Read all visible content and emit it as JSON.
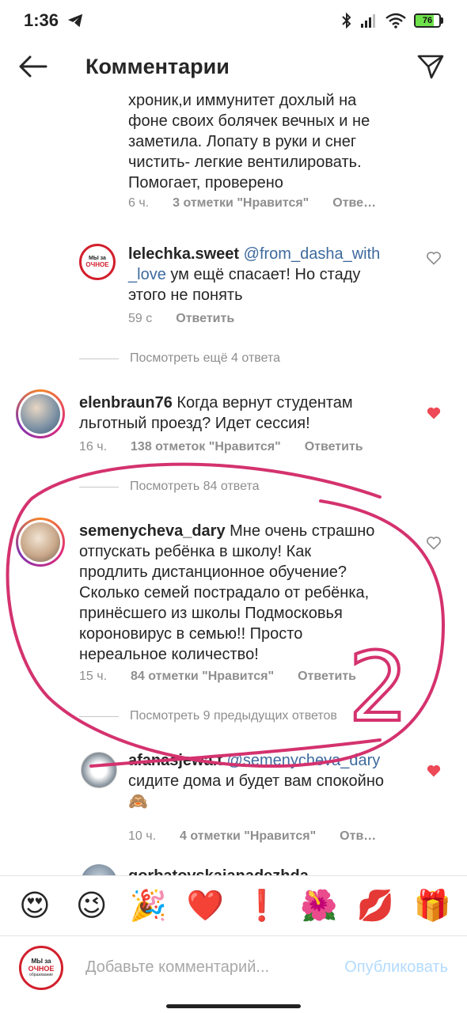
{
  "status": {
    "time": "1:36",
    "battery": "76",
    "battery_level": 0.76
  },
  "header": {
    "title": "Комментарии"
  },
  "comments": [
    {
      "text_lines": [
        "хроник,и иммунитет дохлый  на",
        "фоне своих болячек вечных и не",
        "заметила. Лопату в руки и снег",
        "чистить- легкие вентилировать.",
        "Помогает, проверено"
      ],
      "time": "6 ч.",
      "likes": "3 отметки \"Нравится\"",
      "reply": "Отве…"
    },
    {
      "username": "lelechka.sweet",
      "mention_a": "@from_dasha_with",
      "mention_b": "_love",
      "text_a": " ум ещё спасает! Но стаду",
      "text_b": "этого не понять",
      "time": "59 с",
      "reply": "Ответить"
    },
    {
      "view_more": "Посмотреть ещё 4 ответа"
    },
    {
      "username": "elenbraun76",
      "text_a": " Когда вернут студентам",
      "text_b": "льготный проезд? Идет сессия!",
      "time": "16 ч.",
      "likes": "138 отметок \"Нравится\"",
      "reply": "Ответить"
    },
    {
      "view_more": "Посмотреть 84 ответа"
    },
    {
      "username": "semenycheva_dary",
      "text_a": " Мне очень страшно",
      "text_lines": [
        "отпускать ребёнка в школу! Как",
        "продлить дистанционное обучение?",
        "Сколько семей пострадало от ребёнка,",
        "принёсшего из школы Подмосковья",
        "короновирус в семью!! Просто",
        "нереальное количество!"
      ],
      "time": "15 ч.",
      "likes": "84 отметки \"Нравится\"",
      "reply": "Ответить"
    },
    {
      "view_more": "Посмотреть 9 предыдущих ответов"
    },
    {
      "username": "afanasjewa.t",
      "mention_a": "@semenycheva_dary",
      "text_b": "сидите дома и будет вам спокойно",
      "emoji": "🙈",
      "time": "10 ч.",
      "likes": "4 отметки \"Нравится\"",
      "reply": "Отв…"
    },
    {
      "username": "gorbatovskajanadezhda"
    }
  ],
  "logo": {
    "line1": "МЫ за",
    "line2": "ОЧНОЕ",
    "line3": "образование"
  },
  "annotation": {
    "digit": "2"
  },
  "emojis": [
    "😍",
    "😉",
    "🎉",
    "❤️",
    "❗",
    "🌺",
    "💋",
    "🎁"
  ],
  "input": {
    "placeholder": "Добавьте комментарий...",
    "post_label": "Опубликовать"
  },
  "colors": {
    "liked_heart": "#ed4956",
    "mention": "#3d6a9e",
    "annotation": "#d4326e",
    "post_disabled": "#b3dbff"
  }
}
